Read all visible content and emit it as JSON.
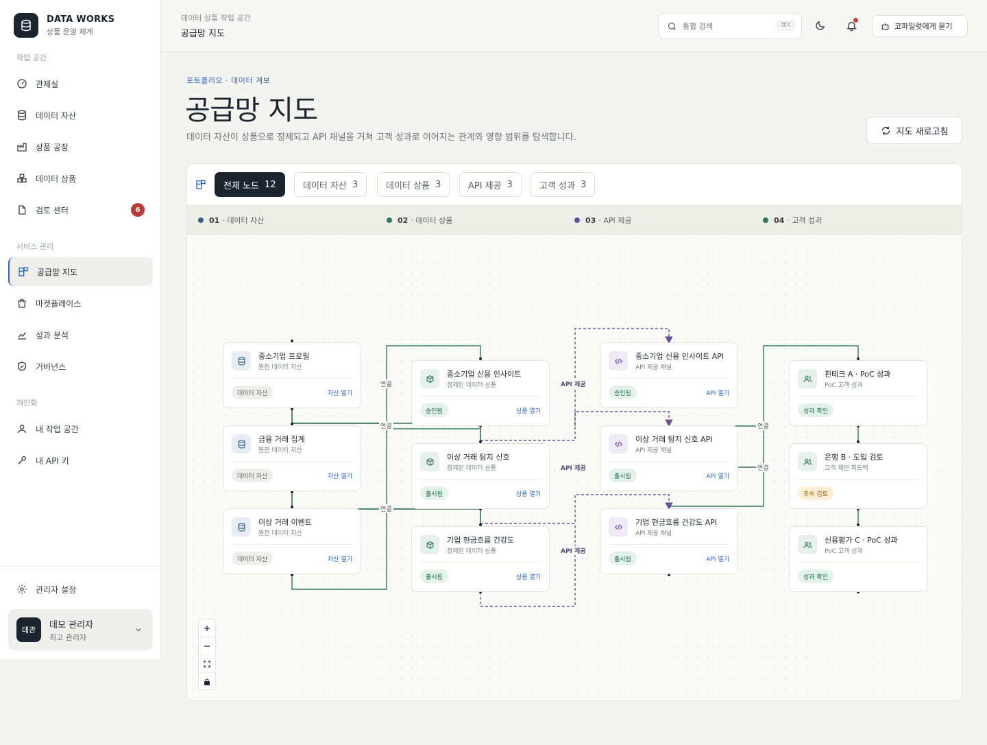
{
  "brand": {
    "name": "DATA WORKS",
    "subtitle": "상품 운영 체계"
  },
  "sidebar": {
    "sections": [
      {
        "label": "작업 공간",
        "items": [
          {
            "label": "관제실",
            "icon": "gauge-icon"
          },
          {
            "label": "데이터 자산",
            "icon": "database-icon"
          },
          {
            "label": "상품 공장",
            "icon": "factory-icon"
          },
          {
            "label": "데이터 상품",
            "icon": "boxes-icon"
          },
          {
            "label": "검토 센터",
            "icon": "file-icon",
            "badge": "6"
          }
        ]
      },
      {
        "label": "서비스 관리",
        "items": [
          {
            "label": "공급망 지도",
            "icon": "blocks-icon",
            "active": true
          },
          {
            "label": "마켓플레이스",
            "icon": "shopping-bag-icon"
          },
          {
            "label": "성과 분석",
            "icon": "chart-icon"
          },
          {
            "label": "거버넌스",
            "icon": "shield-icon"
          }
        ]
      },
      {
        "label": "개인화",
        "items": [
          {
            "label": "내 작업 공간",
            "icon": "user-icon"
          },
          {
            "label": "내 API 키",
            "icon": "key-icon"
          }
        ]
      }
    ],
    "settings_label": "관리자 설정",
    "user": {
      "avatar": "데관",
      "name": "데모 관리자",
      "role": "최고 관리자"
    }
  },
  "topbar": {
    "breadcrumb_small": "데이터 상품 작업 공간",
    "breadcrumb_title": "공급망 지도",
    "search_placeholder": "통합 검색",
    "search_shortcut": "⌘K",
    "copilot_label": "코파일럿에게 묻기"
  },
  "header": {
    "eyebrow": "포트폴리오 · 데이터 계보",
    "title": "공급망 지도",
    "description": "데이터 자산이 상품으로 정제되고 API 채널을 거쳐 고객 성과로 이어지는 관계와 영향 범위를 탐색합니다.",
    "refresh_label": "지도 새로고침"
  },
  "tabs": [
    {
      "label": "전체 노드",
      "count": "12",
      "active": true
    },
    {
      "label": "데이터 자산",
      "count": "3"
    },
    {
      "label": "데이터 상품",
      "count": "3"
    },
    {
      "label": "API 제공",
      "count": "3"
    },
    {
      "label": "고객 성과",
      "count": "3"
    }
  ],
  "lanes": [
    {
      "num": "01",
      "label": "데이터 자산",
      "color": "#3b5f86"
    },
    {
      "num": "02",
      "label": "데이터 상품",
      "color": "#2f7a52"
    },
    {
      "num": "03",
      "label": "API 제공",
      "color": "#6b4f9a"
    },
    {
      "num": "04",
      "label": "고객 성과",
      "color": "#2f7a52"
    }
  ],
  "edge_labels": {
    "connect": "연결",
    "api": "API 제공"
  },
  "nodes": [
    {
      "title": "중소기업 프로필",
      "subtitle": "원천 데이터 자산",
      "status": "데이터 자산",
      "status_tone": "gray",
      "link": "자산 열기",
      "icon": "database-icon"
    },
    {
      "title": "금융 거래 집계",
      "subtitle": "원천 데이터 자산",
      "status": "데이터 자산",
      "status_tone": "gray",
      "link": "자산 열기",
      "icon": "database-icon"
    },
    {
      "title": "이상 거래 이벤트",
      "subtitle": "원천 데이터 자산",
      "status": "데이터 자산",
      "status_tone": "gray",
      "link": "자산 열기",
      "icon": "database-icon"
    },
    {
      "title": "중소기업 신용 인사이트",
      "subtitle": "정제된 데이터 상품",
      "status": "승인됨",
      "status_tone": "green",
      "link": "상품 열기",
      "icon": "package-icon"
    },
    {
      "title": "이상 거래 탐지 신호",
      "subtitle": "정제된 데이터 상품",
      "status": "출시됨",
      "status_tone": "green",
      "link": "상품 열기",
      "icon": "package-icon"
    },
    {
      "title": "기업 현금흐름 건강도",
      "subtitle": "정제된 데이터 상품",
      "status": "출시됨",
      "status_tone": "green",
      "link": "상품 열기",
      "icon": "package-icon"
    },
    {
      "title": "중소기업 신용 인사이트 API",
      "subtitle": "API 제공 채널",
      "status": "승인됨",
      "status_tone": "green",
      "link": "API 열기",
      "icon": "code-icon"
    },
    {
      "title": "이상 거래 탐지 신호 API",
      "subtitle": "API 제공 채널",
      "status": "출시됨",
      "status_tone": "green",
      "link": "API 열기",
      "icon": "code-icon"
    },
    {
      "title": "기업 현금흐름 건강도 API",
      "subtitle": "API 제공 채널",
      "status": "출시됨",
      "status_tone": "green",
      "link": "API 열기",
      "icon": "code-icon"
    },
    {
      "title": "핀테크 A · PoC 성과",
      "subtitle": "PoC 고객 성과",
      "status": "성과 확인",
      "status_tone": "green",
      "link": "",
      "icon": "users-icon"
    },
    {
      "title": "은행 B · 도입 검토",
      "subtitle": "고객 제안 피드백",
      "status": "후속 검토",
      "status_tone": "amber",
      "link": "",
      "icon": "users-icon"
    },
    {
      "title": "신용평가 C · PoC 성과",
      "subtitle": "PoC 고객 성과",
      "status": "성과 확인",
      "status_tone": "green",
      "link": "",
      "icon": "users-icon"
    }
  ],
  "colors": {
    "accent": "#2f66c9",
    "dark": "#1b2530",
    "connect_edge": "#2f7a52",
    "api_edge": "#6b4f9a",
    "badge": "#b83a36"
  }
}
